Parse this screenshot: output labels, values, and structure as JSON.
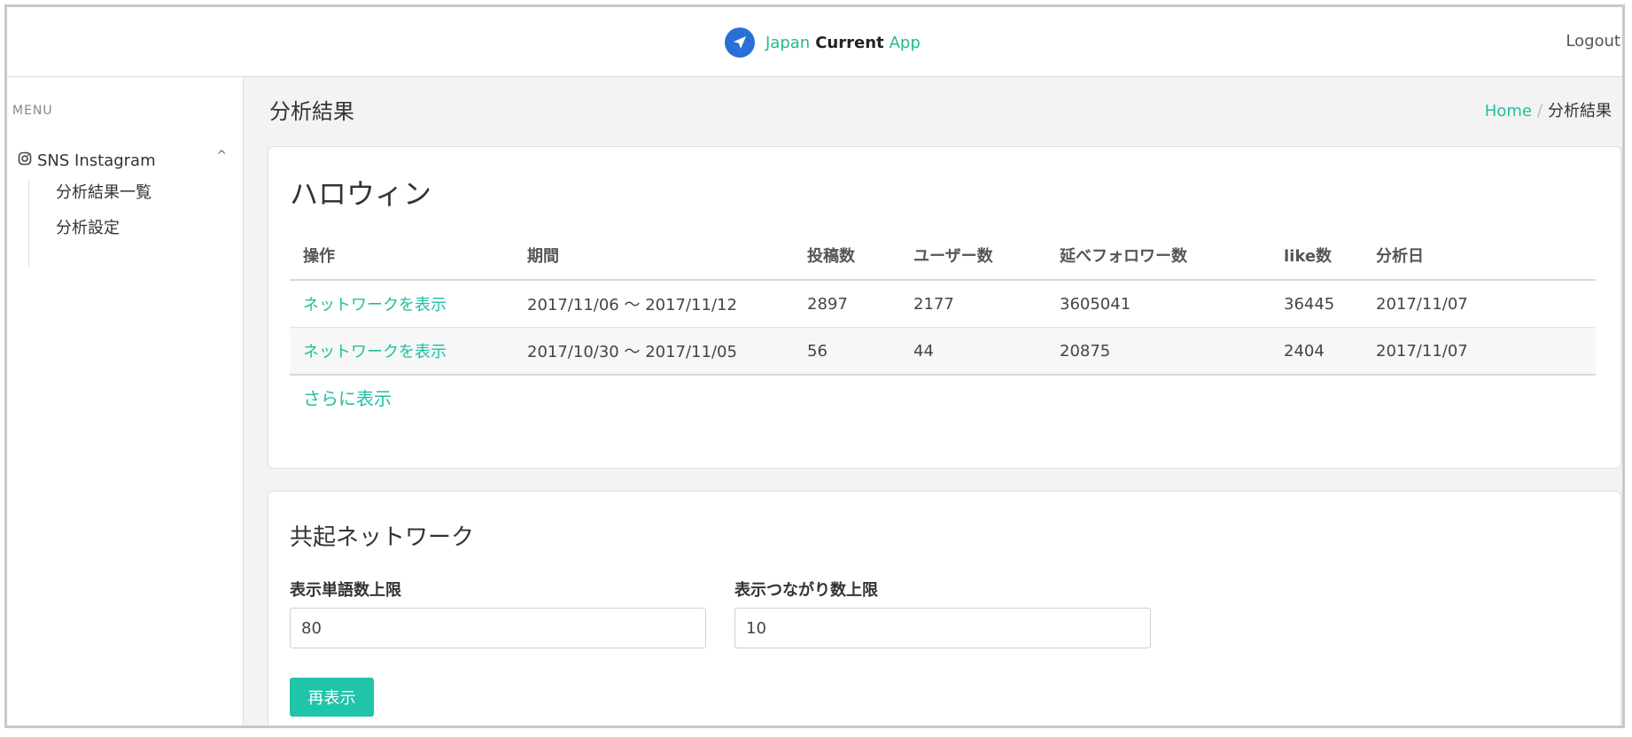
{
  "header": {
    "brand_part1": "Japan",
    "brand_part2": "Current",
    "brand_part3": "App",
    "logout_label": "Logout"
  },
  "sidebar": {
    "menu_label": "MENU",
    "group_label": "SNS Instagram",
    "items": [
      {
        "label": "分析結果一覧"
      },
      {
        "label": "分析設定"
      }
    ]
  },
  "page": {
    "title": "分析結果",
    "breadcrumb": {
      "home": "Home",
      "separator": "/",
      "current": "分析結果"
    }
  },
  "results": {
    "title": "ハロウィン",
    "columns": [
      "操作",
      "期間",
      "投稿数",
      "ユーザー数",
      "延べフォロワー数",
      "like数",
      "分析日"
    ],
    "rows": [
      {
        "action": "ネットワークを表示",
        "period": "2017/11/06 〜 2017/11/12",
        "posts": "2897",
        "users": "2177",
        "followers": "3605041",
        "likes": "36445",
        "date": "2017/11/07"
      },
      {
        "action": "ネットワークを表示",
        "period": "2017/10/30 〜 2017/11/05",
        "posts": "56",
        "users": "44",
        "followers": "20875",
        "likes": "2404",
        "date": "2017/11/07"
      }
    ],
    "more_label": "さらに表示"
  },
  "network": {
    "title": "共起ネットワーク",
    "word_limit_label": "表示単語数上限",
    "word_limit_value": "80",
    "link_limit_label": "表示つながり数上限",
    "link_limit_value": "10",
    "refresh_label": "再表示"
  },
  "colors": {
    "accent": "#1fbf9f",
    "button": "#20c4a8",
    "logo": "#2a6fd6"
  }
}
